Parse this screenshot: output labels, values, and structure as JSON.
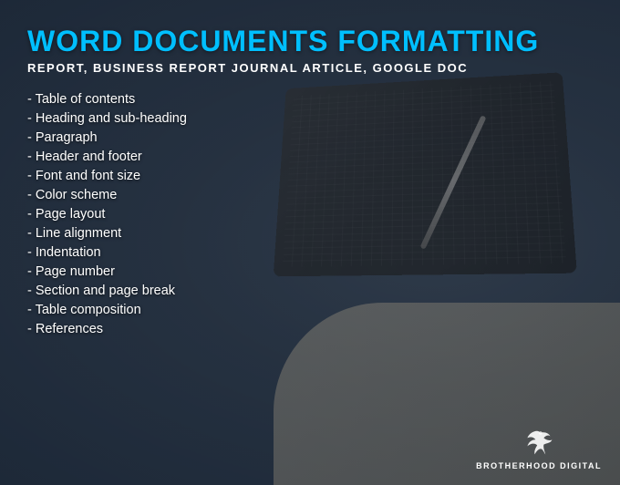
{
  "title": "WORD DOCUMENTS FORMATTING",
  "subtitle": "REPORT, BUSINESS REPORT JOURNAL ARTICLE, GOOGLE DOC",
  "items": [
    {
      "label": "- Table of contents"
    },
    {
      "label": "- Heading and sub-heading"
    },
    {
      "label": "- Paragraph"
    },
    {
      "label": "- Header and footer"
    },
    {
      "label": "- Font and font size"
    },
    {
      "label": "- Color scheme"
    },
    {
      "label": "- Page layout"
    },
    {
      "label": "- Line alignment"
    },
    {
      "label": "- Indentation"
    },
    {
      "label": "- Page number"
    },
    {
      "label": "- Section and page break"
    },
    {
      "label": "- Table composition"
    },
    {
      "label": "- References"
    }
  ],
  "logo": {
    "brand_name": "BROTHERHOOD DIGITAL"
  },
  "colors": {
    "title": "#00bfff",
    "subtitle": "#ffffff",
    "items": "#ffffff"
  }
}
